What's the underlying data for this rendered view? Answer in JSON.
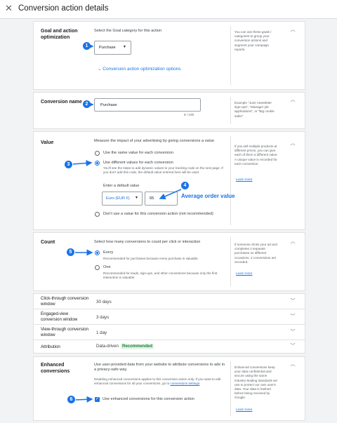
{
  "header": {
    "close_icon": "close-icon",
    "title": "Conversion action details"
  },
  "goal": {
    "title": "Goal and action optimization",
    "instruction": "Select the Goal category for this action",
    "select_value": "Purchase",
    "expand_link": "Conversion action optimization options",
    "side_text": "You can use these goals / categories to group your conversion actions and segment your campaign reports."
  },
  "name": {
    "title": "Conversion name",
    "input_value": "Purchase",
    "counter": "8 / 100",
    "side_text": "Example \"June newsletter sign-ups\", \"Manager job applications\", or \"Big cookie sales\""
  },
  "value": {
    "title": "Value",
    "intro": "Measure the impact of your advertising by giving conversions a value",
    "opt1": "Use the same value for each conversion",
    "opt2": "Use different values for each conversion",
    "opt2_desc": "You'll see the steps to add dynamic values to your tracking code on the next page. If you don't add this code, the default value entered here will be used.",
    "default_label": "Enter a default value",
    "currency": "Euro (EUR €)",
    "amount": "65",
    "opt3": "Don't use a value for this conversion action (not recommended)",
    "annotation": "Average order value",
    "side_text": "If you sell multiple products at different prices, you can give each of them a different value. A unique value is recorded for each conversion.",
    "learn_more": "Learn more"
  },
  "count": {
    "title": "Count",
    "intro": "Select how many conversions to count per click or interaction",
    "every": "Every",
    "every_desc": "Recommended for purchases because every purchase is valuable.",
    "one": "One",
    "one_desc": "Recommended for leads, sign-ups, and other conversions because only the first interaction is valuable.",
    "side_text": "If someone clicks your ad and completes 2 separate purchases on different occasions, 2 conversions are recorded.",
    "learn_more": "Learn more"
  },
  "windows": [
    {
      "label": "Click-through conversion window",
      "value": "30 days"
    },
    {
      "label": "Engaged-view conversion window",
      "value": "3 days"
    },
    {
      "label": "View-through conversion window",
      "value": "1 day"
    }
  ],
  "attribution": {
    "label": "Attribution",
    "value": "Data-driven",
    "badge": "Recommended"
  },
  "enhanced": {
    "title": "Enhanced conversions",
    "intro": "Use user-provided data from your website to attribute conversions to ads in a privacy-safe way.",
    "note_prefix": "Disabling enhanced conversions applies to this conversion action only. If you want to edit enhanced conversions for all your conversions, go to ",
    "note_link": "conversions settings",
    "note_suffix": ".",
    "checkbox_label": "Use enhanced conversions for this conversion action",
    "side_text": "Enhanced conversions keep your data confidential and secure using the same industry-leading standards we use to protect our own user's data. Your data is hashed before being received by Google.",
    "learn_more": "Learn more"
  },
  "badges": [
    "1",
    "2",
    "3",
    "4",
    "5",
    "6"
  ],
  "colors": {
    "accent": "#1a73e8",
    "recommended_bg": "#e6f4ea",
    "recommended_text": "#188038"
  }
}
